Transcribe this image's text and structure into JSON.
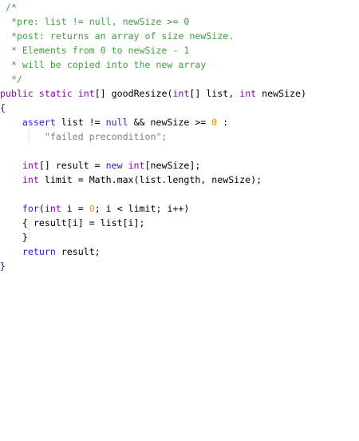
{
  "code_lines": [
    {
      "tokens": [
        {
          "t": "/*",
          "c": "cm"
        }
      ],
      "indent": " "
    },
    {
      "tokens": [
        {
          "t": "*pre: list != null, newSize >= 0",
          "c": "cm"
        }
      ],
      "indent": "  "
    },
    {
      "tokens": [
        {
          "t": "*post: returns an array of size newSize.",
          "c": "cm"
        }
      ],
      "indent": "  "
    },
    {
      "tokens": [
        {
          "t": "* Elements from 0 to newSize - 1",
          "c": "cm"
        }
      ],
      "indent": "  "
    },
    {
      "tokens": [
        {
          "t": "* will be copied into the new array",
          "c": "cm"
        }
      ],
      "indent": "  "
    },
    {
      "tokens": [
        {
          "t": "*/",
          "c": "cm"
        }
      ],
      "indent": "  "
    },
    {
      "tokens": [
        {
          "t": "public",
          "c": "kw"
        },
        {
          "t": " ",
          "c": "plain"
        },
        {
          "t": "static",
          "c": "kw"
        },
        {
          "t": " ",
          "c": "plain"
        },
        {
          "t": "int",
          "c": "kw"
        },
        {
          "t": "[] goodResize(",
          "c": "plain"
        },
        {
          "t": "int",
          "c": "kw"
        },
        {
          "t": "[] list, ",
          "c": "plain"
        },
        {
          "t": "int",
          "c": "kw"
        },
        {
          "t": " newSize)",
          "c": "plain"
        }
      ],
      "indent": ""
    },
    {
      "tokens": [
        {
          "t": "{",
          "c": "brace"
        }
      ],
      "indent": ""
    },
    {
      "tokens": [
        {
          "t": "assert",
          "c": "kb"
        },
        {
          "t": " list != ",
          "c": "plain"
        },
        {
          "t": "null",
          "c": "kb"
        },
        {
          "t": " && newSize >= ",
          "c": "plain"
        },
        {
          "t": "0",
          "c": "num"
        },
        {
          "t": " :",
          "c": "plain"
        }
      ],
      "indent": "    "
    },
    {
      "tokens": [
        {
          "t": "\"failed precondition\";",
          "c": "str"
        }
      ],
      "indent": "        "
    },
    {
      "tokens": [],
      "indent": ""
    },
    {
      "tokens": [
        {
          "t": "int",
          "c": "kw"
        },
        {
          "t": "[] result = ",
          "c": "plain"
        },
        {
          "t": "new",
          "c": "kb"
        },
        {
          "t": " ",
          "c": "plain"
        },
        {
          "t": "int",
          "c": "kw"
        },
        {
          "t": "[newSize];",
          "c": "plain"
        }
      ],
      "indent": "    "
    },
    {
      "tokens": [
        {
          "t": "int",
          "c": "kw"
        },
        {
          "t": " limit = Math.max(list.length, newSize);",
          "c": "plain"
        }
      ],
      "indent": "    "
    },
    {
      "tokens": [],
      "indent": ""
    },
    {
      "tokens": [
        {
          "t": "for",
          "c": "kb"
        },
        {
          "t": "(",
          "c": "plain"
        },
        {
          "t": "int",
          "c": "kw"
        },
        {
          "t": " i = ",
          "c": "plain"
        },
        {
          "t": "0",
          "c": "num"
        },
        {
          "t": "; i < limit; i++)",
          "c": "plain"
        }
      ],
      "indent": "    "
    },
    {
      "tokens": [
        {
          "t": "{ result[i] = list[i];",
          "c": "plain"
        }
      ],
      "indent": "    "
    },
    {
      "tokens": [
        {
          "t": "}",
          "c": "plain"
        }
      ],
      "indent": "    "
    },
    {
      "tokens": [
        {
          "t": "return",
          "c": "kb"
        },
        {
          "t": " result;",
          "c": "plain"
        }
      ],
      "indent": "    "
    },
    {
      "tokens": [
        {
          "t": "}",
          "c": "brace"
        }
      ],
      "indent": ""
    }
  ]
}
